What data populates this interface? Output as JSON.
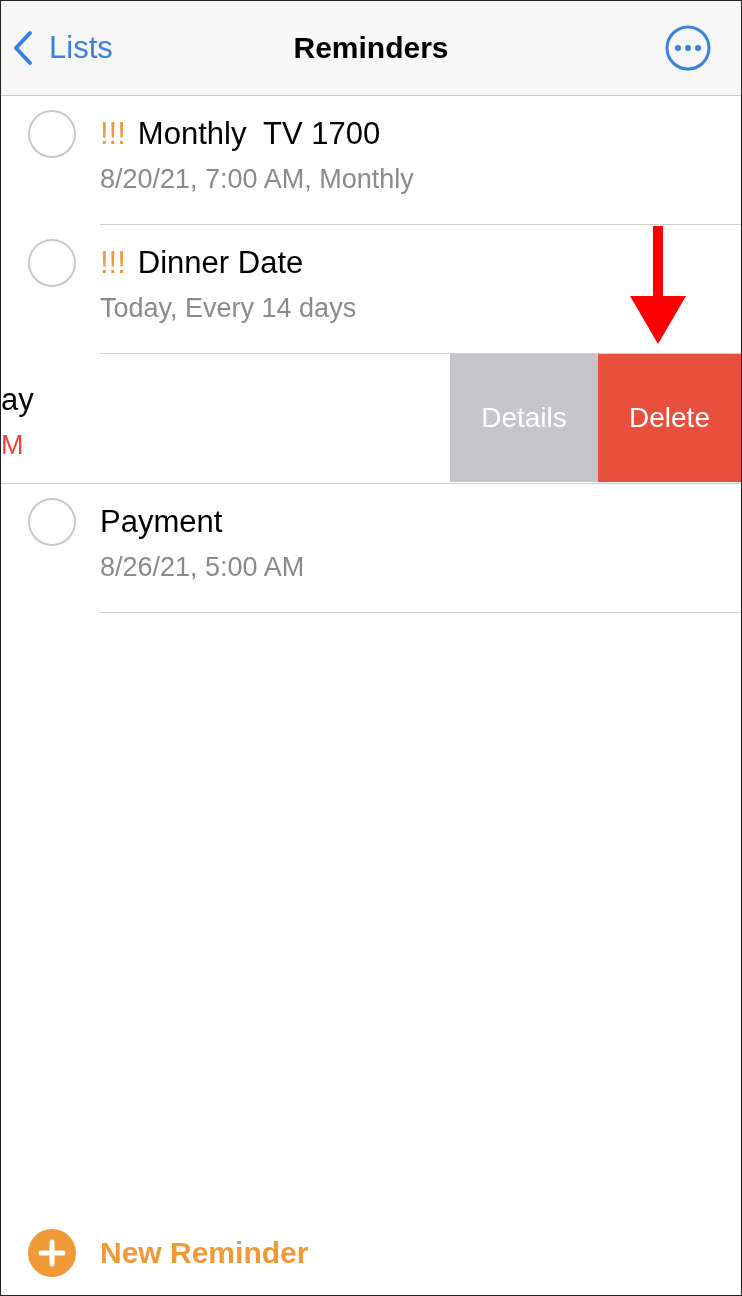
{
  "nav": {
    "back": "Lists",
    "title": "Reminders"
  },
  "reminders": [
    {
      "kind": "normal",
      "priority": "!!!",
      "title": "Monthly  TV 1700",
      "subtitle": "8/20/21, 7:00 AM, Monthly",
      "overdue": false
    },
    {
      "kind": "normal",
      "priority": "!!!",
      "title": "Dinner Date",
      "subtitle": "Today, Every 14 days",
      "overdue": false
    },
    {
      "kind": "swiped",
      "title": "ay",
      "subtitle": "M",
      "overdue": true,
      "actions": [
        {
          "kind": "details",
          "label": "Details"
        },
        {
          "kind": "delete",
          "label": "Delete"
        }
      ]
    },
    {
      "kind": "normal",
      "title": "Payment",
      "subtitle": "8/26/21, 5:00 AM",
      "overdue": false
    }
  ],
  "footer": {
    "label": "New Reminder"
  }
}
